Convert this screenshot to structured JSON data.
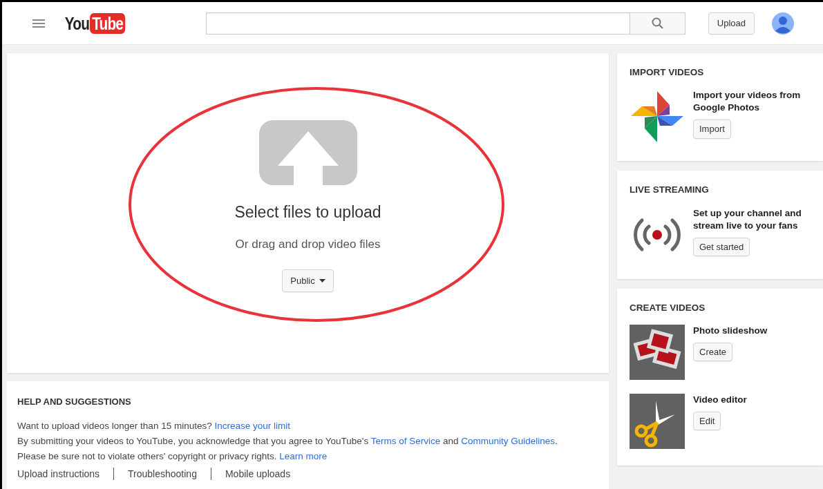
{
  "header": {
    "logo": {
      "you": "You",
      "tube": "Tube"
    },
    "upload_button": "Upload"
  },
  "upload": {
    "title": "Select files to upload",
    "subtitle": "Or drag and drop video files",
    "privacy": "Public",
    "annotated": true
  },
  "help": {
    "title": "HELP AND SUGGESTIONS",
    "lines": [
      [
        {
          "text": "Want to upload videos longer than 15 minutes? ",
          "link": false
        },
        {
          "text": "Increase your limit",
          "link": true
        }
      ],
      [
        {
          "text": "By submitting your videos to YouTube, you acknowledge that you agree to YouTube's ",
          "link": false
        },
        {
          "text": "Terms of Service",
          "link": true
        },
        {
          "text": " and ",
          "link": false
        },
        {
          "text": "Community Guidelines",
          "link": true
        },
        {
          "text": ".",
          "link": false
        }
      ],
      [
        {
          "text": "Please be sure not to violate others' copyright or privacy rights. ",
          "link": false
        },
        {
          "text": "Learn more",
          "link": true
        }
      ]
    ],
    "links": [
      "Upload instructions",
      "Troubleshooting",
      "Mobile uploads"
    ]
  },
  "sidebar": [
    {
      "title": "IMPORT VIDEOS",
      "items": [
        {
          "kind": "photos",
          "text": "Import your videos from Google Photos",
          "button": "Import"
        }
      ]
    },
    {
      "title": "LIVE STREAMING",
      "items": [
        {
          "kind": "live",
          "text": "Set up your channel and stream live to your fans",
          "button": "Get started"
        }
      ]
    },
    {
      "title": "CREATE VIDEOS",
      "items": [
        {
          "kind": "slideshow",
          "text": "Photo slideshow",
          "button": "Create"
        },
        {
          "kind": "editor",
          "text": "Video editor",
          "button": "Edit"
        }
      ]
    }
  ]
}
